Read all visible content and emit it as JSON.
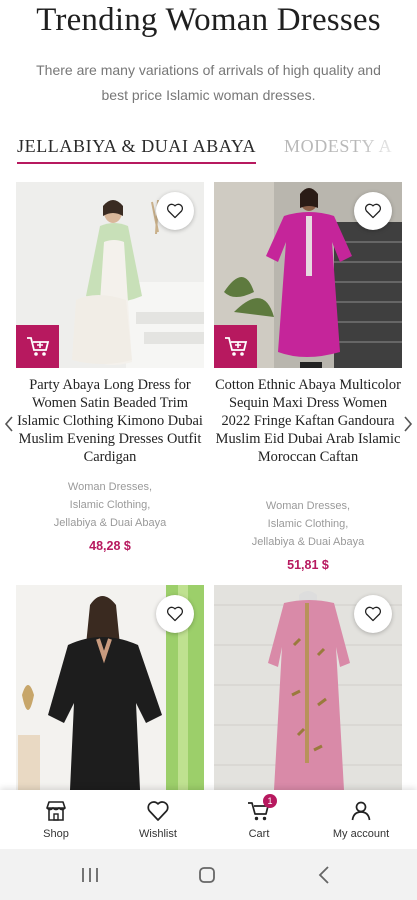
{
  "page": {
    "title": "Trending Woman Dresses",
    "subtitle": "There are many variations of arrivals of high quality and best price Islamic woman dresses."
  },
  "tabs": [
    {
      "label": "JELLABIYA & DUAI ABAYA",
      "active": true
    },
    {
      "label": "MODESTY A",
      "active": false
    }
  ],
  "products": [
    {
      "name": "Party Abaya Long Dress for Women Satin Beaded Trim Islamic Clothing Kimono Dubai Muslim Evening Dresses Outfit Cardigan",
      "categories": [
        "Woman Dresses,",
        "Islamic Clothing,",
        "Jellabiya & Duai Abaya"
      ],
      "price": "48,28 $"
    },
    {
      "name": "Cotton Ethnic Abaya Multicolor Sequin Maxi Dress Women 2022 Fringe Kaftan Gandoura Muslim Eid Dubai Arab Islamic Moroccan Caftan",
      "categories": [
        "Woman Dresses,",
        "Islamic Clothing,",
        "Jellabiya & Duai Abaya"
      ],
      "price": "51,81 $"
    },
    {
      "name": "",
      "categories": [],
      "price": ""
    },
    {
      "name": "",
      "categories": [],
      "price": ""
    }
  ],
  "bottom_nav": [
    {
      "label": "Shop",
      "icon": "shop-icon"
    },
    {
      "label": "Wishlist",
      "icon": "heart-icon"
    },
    {
      "label": "Cart",
      "icon": "cart-icon",
      "badge": "1"
    },
    {
      "label": "My account",
      "icon": "user-icon"
    }
  ],
  "colors": {
    "accent": "#b7195f",
    "text": "#222222",
    "muted": "#9a9a9a"
  }
}
